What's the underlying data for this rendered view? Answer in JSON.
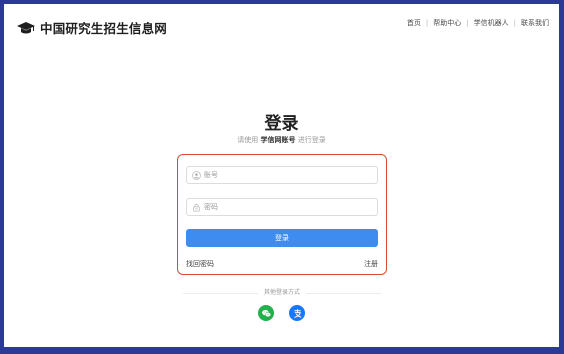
{
  "header": {
    "site_title": "中国研究生招生信息网",
    "logo_icon": "graduation-cap-icon",
    "nav": [
      {
        "label": "首页"
      },
      {
        "label": "帮助中心"
      },
      {
        "label": "学信机器人"
      },
      {
        "label": "联系我们"
      }
    ]
  },
  "login": {
    "title": "登录",
    "subtitle_prefix": "请使用",
    "subtitle_account": "学信网账号",
    "subtitle_suffix": "进行登录",
    "username_placeholder": "账号",
    "username_value": "",
    "username_icon": "user-icon",
    "password_placeholder": "密码",
    "password_value": "",
    "password_icon": "lock-icon",
    "submit_label": "登录",
    "forgot_label": "找回密码",
    "register_label": "注册"
  },
  "other_login": {
    "label": "其他登录方式",
    "methods": [
      {
        "icon": "wechat-icon",
        "color": "#22b04b"
      },
      {
        "icon": "alipay-icon",
        "color": "#1677ff"
      }
    ]
  },
  "colors": {
    "frame_background": "#2b3a97",
    "primary_button": "#3f8cf0",
    "form_highlight_border": "#d94a3a"
  }
}
